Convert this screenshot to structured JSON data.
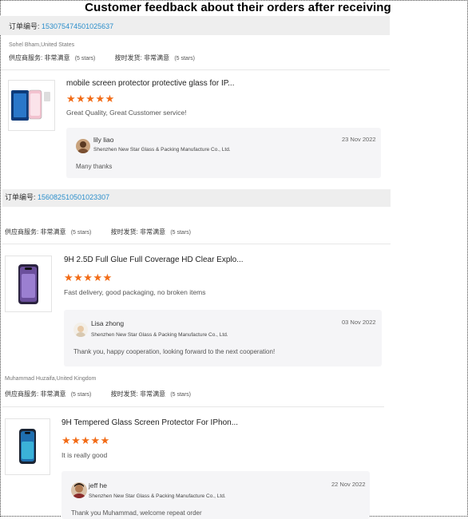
{
  "page_title": "Customer feedback about their orders after receiving",
  "labels": {
    "order_no": "订单编号:",
    "supplier_service": "供应商服务:",
    "on_time": "按时发货:",
    "very_satisfied": "非常满意",
    "five_stars": "(5 stars)"
  },
  "colors": {
    "star": "#f26b16",
    "order_link": "#2b8ecb",
    "order_bar": "#eeeeee"
  },
  "orders": [
    {
      "order_number": "153075474501025637",
      "buyer": "Sohel Bham,United States",
      "product_title": "mobile screen protector protective glass for IP...",
      "stars": "★★★★★",
      "rating": 5,
      "review": "Great Quality, Great Cusstomer service!",
      "reply": {
        "name": "lily liao",
        "company": "Shenzhen New Star Glass & Packing Manufacture Co., Ltd.",
        "date": "23 Nov 2022",
        "text": "Many thanks"
      }
    },
    {
      "order_number": "156082510501023307",
      "buyer": "",
      "product_title": "9H 2.5D Full Glue Full Coverage HD Clear Explo...",
      "stars": "★★★★★",
      "rating": 5,
      "review": "Fast delivery, good packaging, no broken items",
      "reply": {
        "name": "Lisa zhong",
        "company": "Shenzhen New Star Glass & Packing Manufacture Co., Ltd.",
        "date": "03 Nov 2022",
        "text": "Thank you, happy cooperation, looking forward to the next cooperation!"
      }
    },
    {
      "order_number": "",
      "buyer": "Muhammad Huzaifa,United Kingdom",
      "product_title": "9H Tempered Glass Screen Protector For IPhon...",
      "stars": "★★★★★",
      "rating": 5,
      "review": "It is really good",
      "reply": {
        "name": "jeff he",
        "company": "Shenzhen New Star Glass & Packing Manufacture Co., Ltd.",
        "date": "22 Nov 2022",
        "text": "Thank you Muhammad, welcome repeat order"
      }
    }
  ]
}
